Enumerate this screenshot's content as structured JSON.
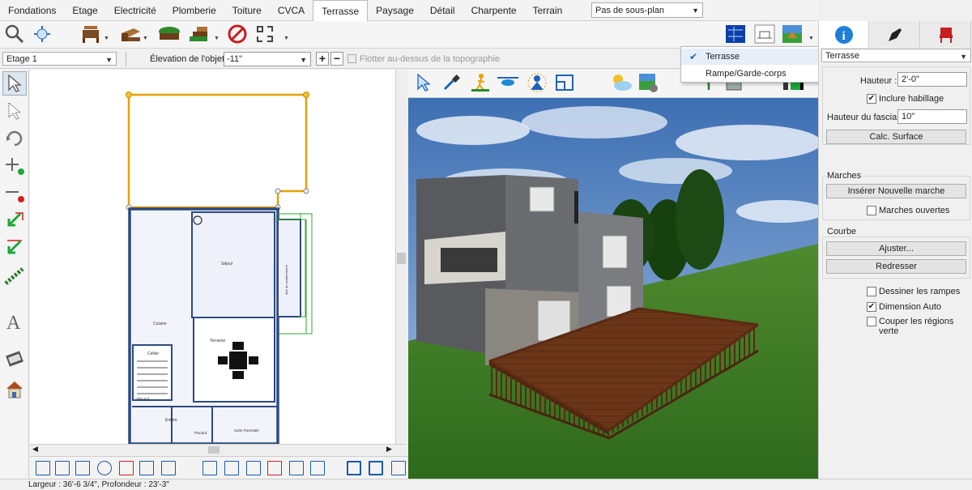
{
  "menu": {
    "tabs": [
      "Fondations",
      "Etage",
      "Electricité",
      "Plomberie",
      "Toiture",
      "CVCA",
      "Terrasse",
      "Paysage",
      "Détail",
      "Charpente",
      "Terrain"
    ],
    "active_tab": "Terrasse",
    "plan_select": "Pas de sous-plan"
  },
  "objbar": {
    "floor": "Etage 1",
    "elevation_label": "Élevation de l'objet:",
    "elevation_value": "-11\"",
    "float_label": "Flotter au-dessus de la topographie"
  },
  "dropdown": {
    "items": [
      {
        "label": "Terrasse",
        "checked": true
      },
      {
        "label": "Rampe/Garde-corps",
        "checked": false
      }
    ]
  },
  "right_panel": {
    "object_type": "Terrasse",
    "height_label": "Hauteur :",
    "height_value": "2'-0\"",
    "include_trim": "Inclure habillage",
    "include_trim_checked": true,
    "fascia_label": "Hauteur du fascia:",
    "fascia_value": "10\"",
    "calc_button": "Calc. Surface",
    "stairs_group": "Marches",
    "insert_stair_button": "Insérer Nouvelle marche",
    "open_stairs": "Marches ouvertes",
    "curve_group": "Courbe",
    "adjust_button": "Ajuster...",
    "straighten_button": "Redresser",
    "draw_ramps": "Dessiner les rampes",
    "auto_dimension": "Dimension Auto",
    "auto_dimension_checked": true,
    "cut_regions": "Couper les régions verte"
  },
  "plan": {
    "rooms": {
      "sejour": "Séjour",
      "cuisine": "Cuisine",
      "terrasse": "Terrasse",
      "cellier": "Cellier",
      "placard1": "Placard",
      "placard2": "Placard",
      "entree": "Entrée",
      "suite": "Suite Parentale",
      "side": "Mur de soutènement"
    }
  },
  "status": "Largeur : 36'-6 3/4\", Profondeur : 23'-3\"",
  "colors": {
    "deck_outline": "#e6a000",
    "wall": "#2d4a80",
    "accent": "#1f63b8",
    "deck_wood": "#6b3518",
    "grass": "#3f7a24",
    "sky": "#5a8ac6"
  }
}
